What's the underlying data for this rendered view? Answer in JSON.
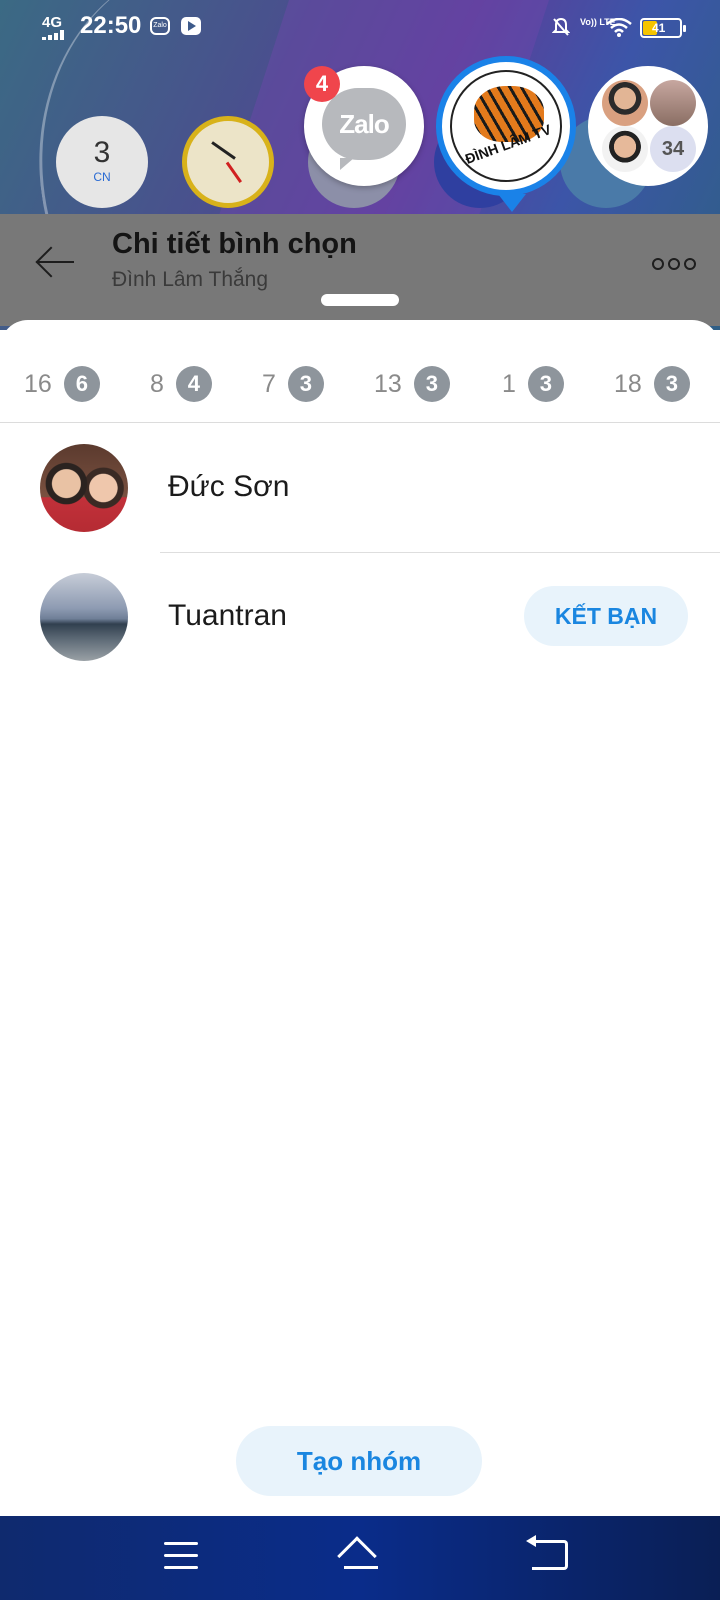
{
  "status_bar": {
    "network": "4G",
    "time": "22:50",
    "notif_zalo_label": "Zalo",
    "volte": "Vo)) LTE",
    "battery": "41"
  },
  "home_widgets": {
    "calendar_day": "3",
    "calendar_weekday": "CN"
  },
  "chat_heads": {
    "zalo_label": "Zalo",
    "zalo_badge": "4",
    "tiger_label": "ĐÌNH LÂM TV",
    "group_count": "34"
  },
  "header": {
    "title": "Chi tiết bình chọn",
    "subtitle": "Đình Lâm Thắng"
  },
  "tabs": [
    {
      "label": "16",
      "count": "6"
    },
    {
      "label": "8",
      "count": "4"
    },
    {
      "label": "7",
      "count": "3"
    },
    {
      "label": "13",
      "count": "3"
    },
    {
      "label": "1",
      "count": "3"
    },
    {
      "label": "18",
      "count": "3"
    }
  ],
  "voters": [
    {
      "name": "Đức Sơn"
    },
    {
      "name": "Tuantran",
      "action": "KẾT BẠN"
    }
  ],
  "create_group_label": "Tạo nhóm",
  "colors": {
    "accent": "#1a86e0",
    "button_bg": "#e8f3fb",
    "badge_red": "#f0454c",
    "tab_count_bg": "#8e959c",
    "nav_bg": "#0a2c8a"
  }
}
